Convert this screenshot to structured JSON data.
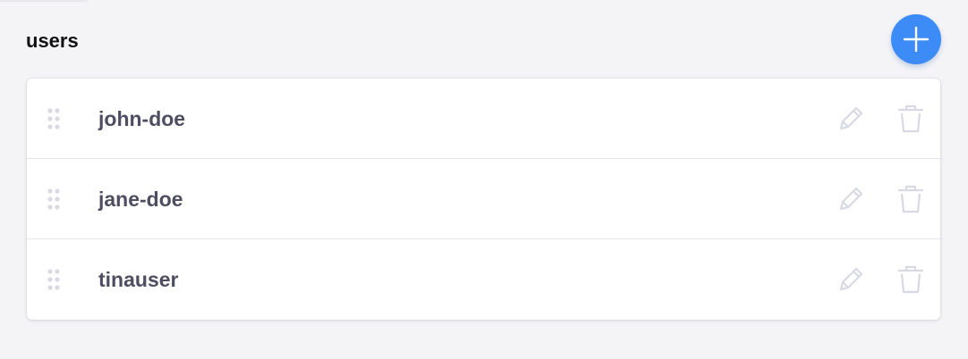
{
  "header": {
    "title": "users"
  },
  "colors": {
    "background": "#f4f4f7",
    "accent": "#3c8bf7",
    "card": "#ffffff",
    "text": "#4e4d61",
    "icon_muted": "#d9d9e3"
  },
  "icons": {
    "add": "plus-icon",
    "drag": "drag-handle-icon",
    "edit": "pencil-icon",
    "delete": "trash-icon"
  },
  "users": [
    {
      "name": "john-doe"
    },
    {
      "name": "jane-doe"
    },
    {
      "name": "tinauser"
    }
  ]
}
